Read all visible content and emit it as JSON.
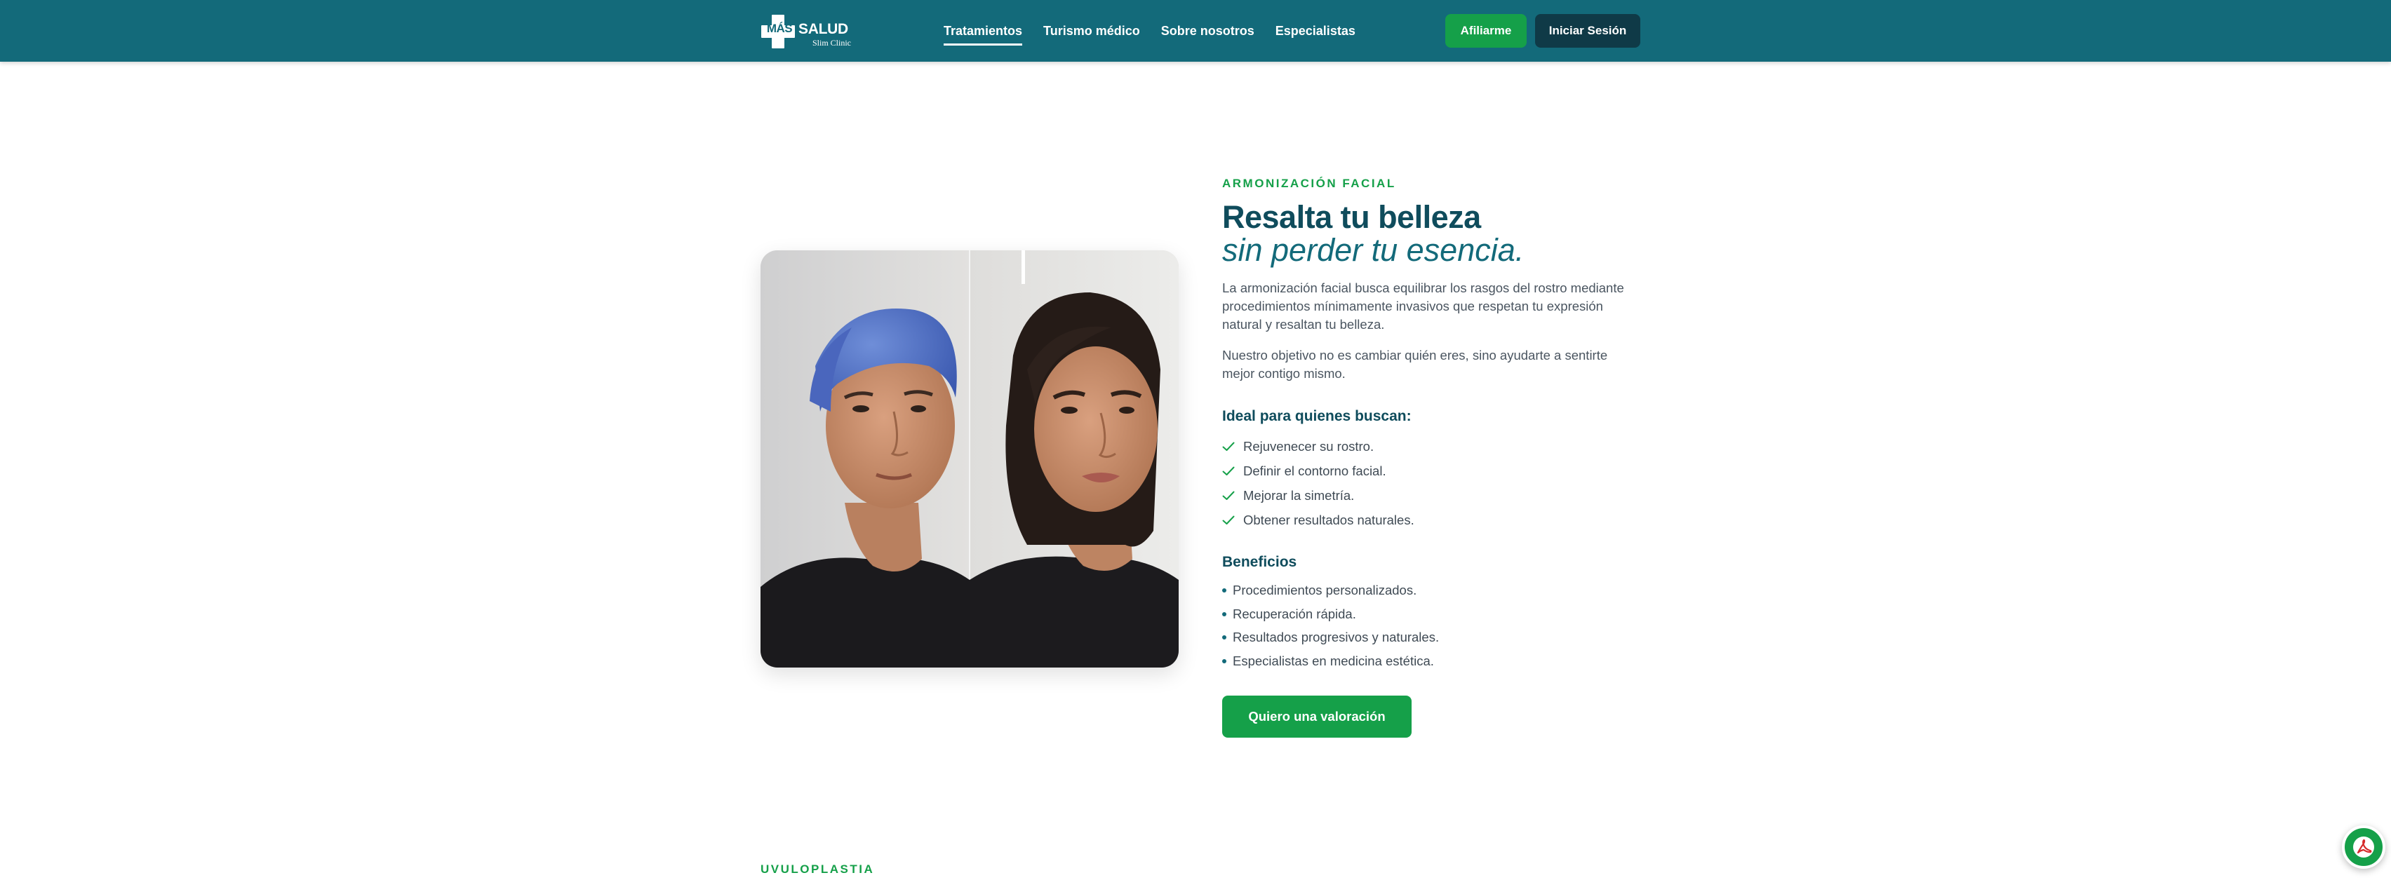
{
  "brand": {
    "logo_mark": "MÁS",
    "logo_word": "SALUD",
    "logo_sub": "Slim Clinic"
  },
  "nav": {
    "items": [
      {
        "label": "Tratamientos",
        "active": true
      },
      {
        "label": "Turismo médico",
        "active": false
      },
      {
        "label": "Sobre nosotros",
        "active": false
      },
      {
        "label": "Especialistas",
        "active": false
      }
    ],
    "affiliate_label": "Afiliarme",
    "login_label": "Iniciar Sesión"
  },
  "section": {
    "eyebrow": "ARMONIZACIÓN FACIAL",
    "title": "Resalta tu belleza",
    "title_italic": "sin perder tu esencia.",
    "paragraphs": [
      "La armonización facial busca equilibrar los rasgos del rostro mediante procedimientos mínimamente invasivos que respetan tu expresión natural y resaltan tu belleza.",
      "Nuestro objetivo no es cambiar quién eres, sino ayudarte a sentirte mejor contigo mismo."
    ],
    "ideal_heading": "Ideal para quienes buscan:",
    "ideal_items": [
      "Rejuvenecer su rostro.",
      "Definir el contorno facial.",
      "Mejorar la simetría.",
      "Obtener resultados naturales."
    ],
    "benefits_heading": "Beneficios",
    "benefits_items": [
      "Procedimientos personalizados.",
      "Recuperación rápida.",
      "Resultados progresivos y naturales.",
      "Especialistas en medicina estética."
    ],
    "cta_label": "Quiero una valoración"
  },
  "next_section": {
    "eyebrow": "UVULOPLASTIA"
  },
  "icons": {
    "check": "check-icon",
    "floating": "acrobat-icon"
  },
  "colors": {
    "header": "#136a7a",
    "accent_green": "#15a049",
    "dark_teal": "#0f3a47",
    "heading": "#0f4c5c"
  }
}
